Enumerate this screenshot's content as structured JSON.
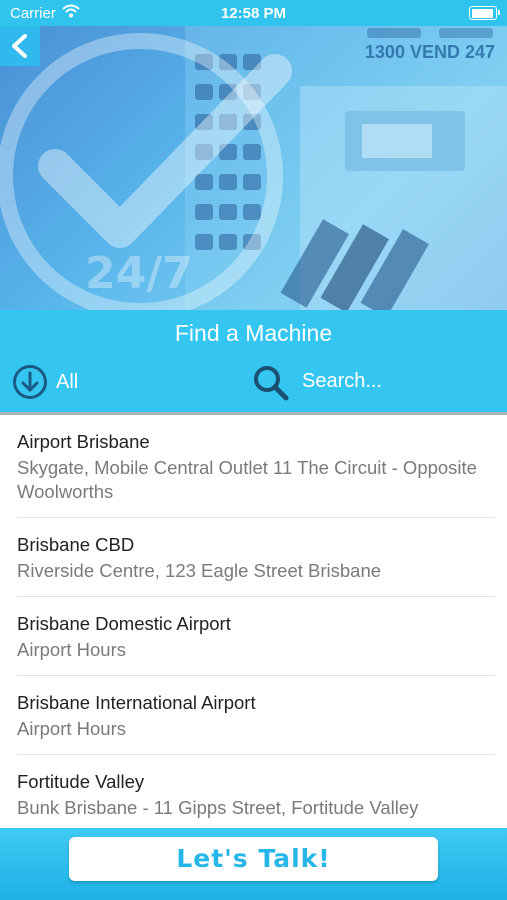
{
  "status_bar": {
    "carrier": "Carrier",
    "time": "12:58 PM"
  },
  "hero": {
    "phone": "1300 VEND 247",
    "logo_text": "24/7"
  },
  "panel": {
    "title": "Find a Machine",
    "filter_label": "All",
    "search_placeholder": "Search..."
  },
  "locations": [
    {
      "name": "Airport Brisbane",
      "address": "Skygate, Mobile Central Outlet 11 The Circuit - Opposite Woolworths"
    },
    {
      "name": "Brisbane CBD",
      "address": "Riverside Centre, 123 Eagle Street Brisbane"
    },
    {
      "name": "Brisbane Domestic Airport",
      "address": "Airport Hours"
    },
    {
      "name": "Brisbane International Airport",
      "address": "Airport Hours"
    },
    {
      "name": "Fortitude Valley",
      "address": "Bunk Brisbane - 11 Gipps Street, Fortitude Valley"
    }
  ],
  "footer": {
    "cta_label": "Let's Talk!"
  },
  "colors": {
    "accent": "#35c5f1",
    "status": "#30c3ee",
    "cta_text": "#27b6e8"
  },
  "icons": [
    "wifi-icon",
    "battery-icon",
    "back-chevron-icon",
    "download-circle-icon",
    "search-icon"
  ]
}
